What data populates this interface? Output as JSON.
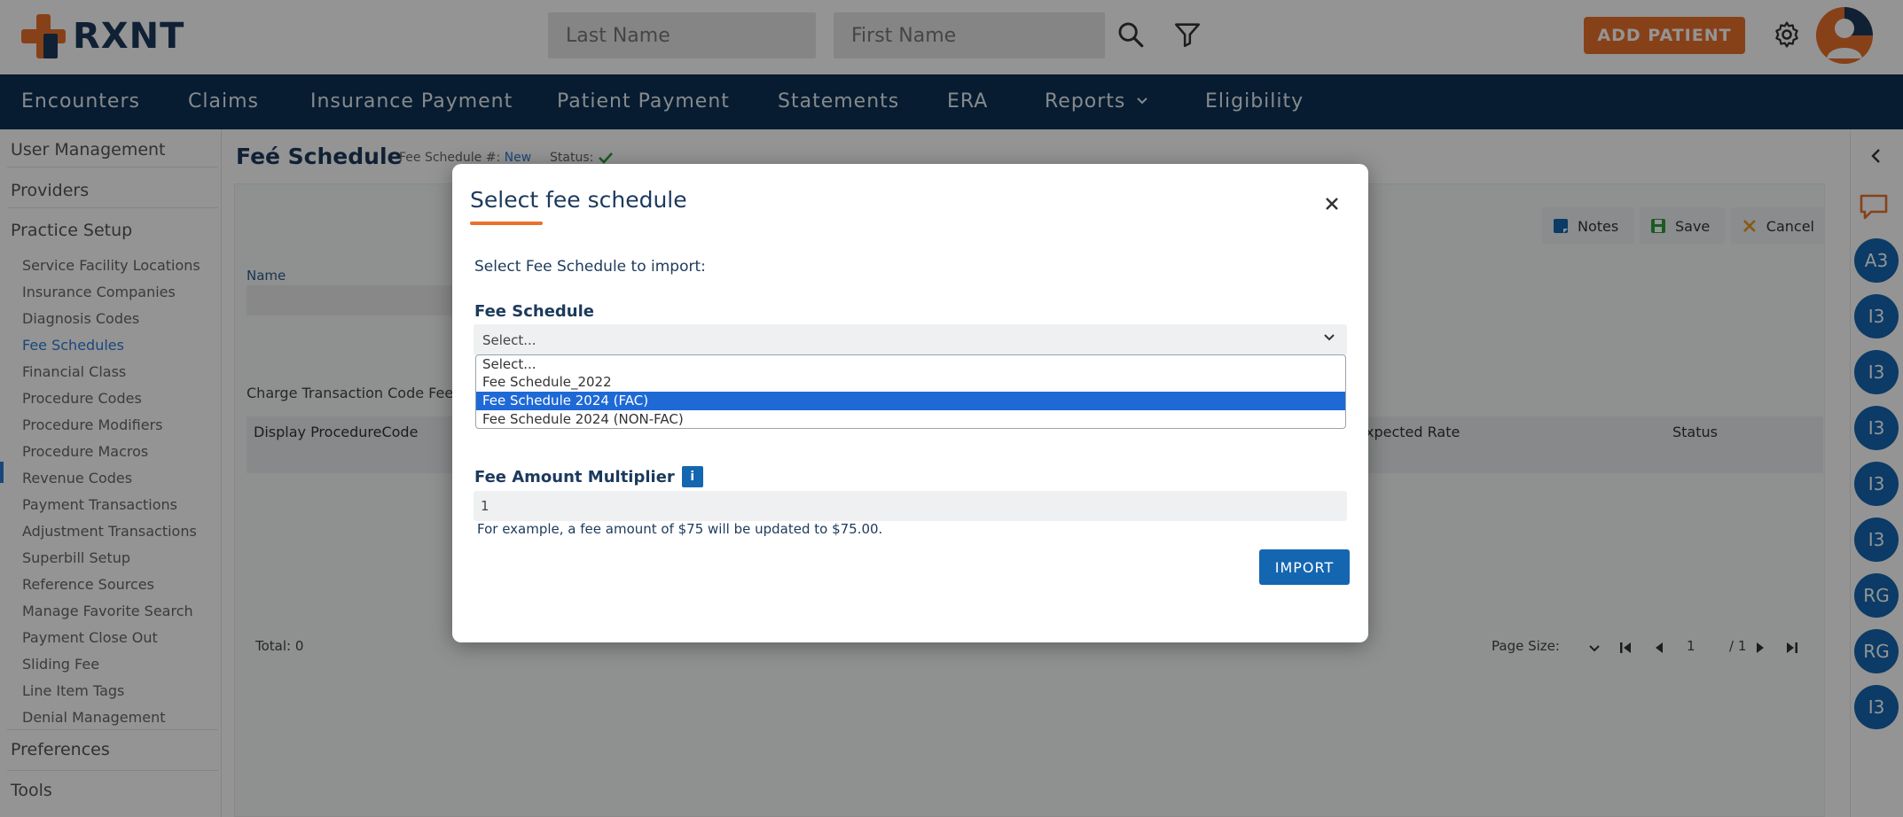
{
  "header": {
    "logo_text": "RXNT",
    "last_name_placeholder": "Last Name",
    "first_name_placeholder": "First Name",
    "add_patient_label": "ADD PATIENT"
  },
  "nav": {
    "items": [
      "Encounters",
      "Claims",
      "Insurance Payment",
      "Patient Payment",
      "Statements",
      "ERA",
      "Reports",
      "Eligibility"
    ]
  },
  "sidebar": {
    "main_items": [
      "User Management",
      "Providers",
      "Practice Setup",
      "Preferences",
      "Tools"
    ],
    "sub_items": [
      "Service Facility Locations",
      "Insurance Companies",
      "Diagnosis Codes",
      "Fee Schedules",
      "Financial Class",
      "Procedure Codes",
      "Procedure Modifiers",
      "Procedure Macros",
      "Revenue Codes",
      "Payment Transactions",
      "Adjustment Transactions",
      "Superbill Setup",
      "Reference Sources",
      "Manage Favorite Search",
      "Payment Close Out",
      "Sliding Fee",
      "Line Item Tags",
      "Denial Management"
    ],
    "active_sub_item": "Fee Schedules"
  },
  "page": {
    "title": "Feé Schedule",
    "fee_schedule_label": "Fee Schedule #:",
    "fee_schedule_value": "New",
    "status_label": "Status:",
    "name_label": "Name",
    "charge_section_label": "Charge Transaction Code Fee",
    "notes_label": "Notes",
    "save_label": "Save",
    "cancel_label": "Cancel",
    "grid_columns": [
      "Display ProcedureCode",
      "xpected Rate",
      "Status"
    ],
    "total_label": "Total: 0",
    "page_size_label": "Page Size:",
    "page_number": "1",
    "page_total": "/ 1"
  },
  "right_rail": {
    "badges": [
      "A3",
      "I3",
      "I3",
      "I3",
      "I3",
      "I3",
      "RG",
      "RG",
      "I3"
    ]
  },
  "modal": {
    "title": "Select fee schedule",
    "subtitle": "Select Fee Schedule to import:",
    "fee_schedule_label": "Fee Schedule",
    "select_value": "Select...",
    "options": [
      "Select...",
      "Fee Schedule_2022",
      "Fee Schedule 2024 (FAC)",
      "Fee Schedule 2024 (NON-FAC)"
    ],
    "highlighted_option": "Fee Schedule 2024 (FAC)",
    "multiplier_label": "Fee Amount Multiplier",
    "multiplier_info": "i",
    "multiplier_value": "1",
    "example_text": "For example, a fee amount of $75 will be updated to $75.00.",
    "import_label": "IMPORT"
  },
  "colors": {
    "brand_orange": "#e8712b",
    "brand_navy": "#0d3153",
    "primary_blue": "#1466b0",
    "highlight_blue": "#1e69d6"
  }
}
